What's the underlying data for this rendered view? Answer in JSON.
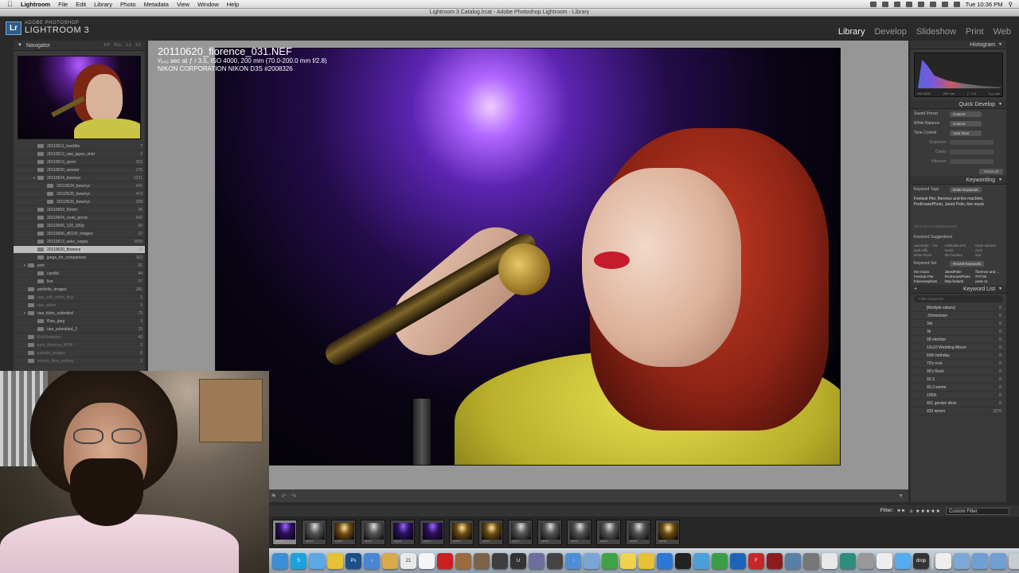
{
  "menubar": {
    "app_name": "Lightroom",
    "items": [
      "File",
      "Edit",
      "Library",
      "Photo",
      "Metadata",
      "View",
      "Window",
      "Help"
    ],
    "clock": "Tue 10:36 PM"
  },
  "window": {
    "title": "Lightroom 3 Catalog.lrcat - Adobe Photoshop Lightroom - Library"
  },
  "identity_plate": {
    "logo": "Lr",
    "small": "ADOBE PHOTOSHOP",
    "big": "LIGHTROOM 3"
  },
  "modules": [
    "Library",
    "Develop",
    "Slideshow",
    "Print",
    "Web"
  ],
  "navigator": {
    "title": "Navigator",
    "options": [
      "FIT",
      "FILL",
      "1:1",
      "3:1"
    ]
  },
  "folders": [
    {
      "name": "20110511_backlite",
      "count": "7",
      "indent": 2
    },
    {
      "name": "20110512_raw_japan_shirt",
      "count": "2",
      "indent": 2
    },
    {
      "name": "20110513_jared",
      "count": "263",
      "indent": 2
    },
    {
      "name": "20110520_weezer",
      "count": "175",
      "indent": 2
    },
    {
      "name": "20110524_bwwnyc",
      "count": "1221",
      "indent": 2,
      "open": true
    },
    {
      "name": "20110524_bwwnyc",
      "count": "420",
      "indent": 3
    },
    {
      "name": "20110525_bwwnyc",
      "count": "473",
      "indent": 3
    },
    {
      "name": "20110526_bwwnyc",
      "count": "328",
      "indent": 3
    },
    {
      "name": "20110603_50mm",
      "count": "36",
      "indent": 2
    },
    {
      "name": "20110604_roots_picnic",
      "count": "542",
      "indent": 2
    },
    {
      "name": "20110606_120_300p",
      "count": "30",
      "indent": 2
    },
    {
      "name": "20110606_d5100_images",
      "count": "22",
      "indent": 2
    },
    {
      "name": "20110613_sebc_vegas",
      "count": "1029",
      "indent": 2
    },
    {
      "name": "20110620_florence",
      "count": "94",
      "indent": 2,
      "selected": true
    },
    {
      "name": "jpegs_for_comparison",
      "count": "162",
      "indent": 2
    },
    {
      "name": "port",
      "count": "81",
      "indent": 1,
      "open": true
    },
    {
      "name": "candid",
      "count": "44",
      "indent": 2
    },
    {
      "name": "live",
      "count": "37",
      "indent": 2
    },
    {
      "name": "portfolio_images",
      "count": "181",
      "indent": 1
    },
    {
      "name": "raw_edit_video_dng",
      "count": "1",
      "indent": 1,
      "dim": true
    },
    {
      "name": "raw_edom",
      "count": "1",
      "indent": 1,
      "dim": true
    },
    {
      "name": "raw_folen_submited",
      "count": "73",
      "indent": 1,
      "open": true
    },
    {
      "name": "Raw_jpeg",
      "count": "3",
      "indent": 2
    },
    {
      "name": "raw_submitted_2",
      "count": "23",
      "indent": 2
    },
    {
      "name": "RichSamples",
      "count": "43",
      "indent": 1,
      "dim": true
    },
    {
      "name": "sam_florence_RPW",
      "count": "2",
      "indent": 1,
      "dim": true
    },
    {
      "name": "sample_images",
      "count": "6",
      "indent": 1,
      "dim": true
    },
    {
      "name": "screen_flow_waiting",
      "count": "1",
      "indent": 1,
      "dim": true
    }
  ],
  "loupe": {
    "filename": "20110620_florence_031.NEF",
    "exposure": "¹⁄₆₄₀ sec at ƒ / 3.5, ISO 4000, 200 mm (70.0-200.0 mm f/2.8)",
    "camera": "NIKON CORPORATION NIKON D3S #2008326"
  },
  "right_panel": {
    "histogram_title": "Histogram",
    "histogram_info": [
      "ISO 4000",
      "200 mm",
      "ƒ / 3.5",
      "¹⁄₆₄₀ sec"
    ],
    "quick_develop": {
      "title": "Quick Develop",
      "saved_preset_label": "Saved Preset",
      "saved_preset_value": "Custom",
      "white_balance_label": "White Balance",
      "white_balance_value": "Custom",
      "tone_control_label": "Tone Control",
      "auto_tone": "Auto Tone",
      "exposure": "Exposure",
      "clarity": "Clarity",
      "vibrance": "Vibrance",
      "reset": "Reset All"
    },
    "keywording": {
      "title": "Keywording",
      "tags_label": "Keyword Tags",
      "tags_mode": "Enter Keywords",
      "tags_text": "Festival Pier, florence and the machine, ProKnowsPhoto, Jared Polin, live music",
      "click_hint": "Click here to add keywords",
      "suggestions_title": "Keyword Suggestions",
      "suggestions": [
        "automatic : hrs",
        "editsuitecaml",
        "brian weaver",
        "walt taffy",
        "music",
        "rock",
        "Brian Rose",
        "the hooters",
        "live"
      ],
      "set_label": "Keyword Set",
      "set_value": "Recent Keywords",
      "set_items": [
        "live music",
        "JaredPolin",
        "florence and ...",
        "Festival Pier",
        "ProKnowsPhoto",
        "POTW",
        "froknowsphoto",
        "http://adsetl",
        "potw 11"
      ]
    },
    "keyword_list": {
      "title": "Keyword List",
      "filter_placeholder": "Filter Keywords",
      "items": [
        {
          "name": "[Multiple values]",
          "count": "0"
        },
        {
          "name": ".Shinedown",
          "count": "0"
        },
        {
          "name": "3rb",
          "count": "0"
        },
        {
          "name": "3k",
          "count": "0"
        },
        {
          "name": "08 election",
          "count": "0"
        },
        {
          "name": "10x10 Wedding Album",
          "count": "0"
        },
        {
          "name": "60th birthday",
          "count": "0"
        },
        {
          "name": "70's rock",
          "count": "0"
        },
        {
          "name": "90's Rock",
          "count": "0"
        },
        {
          "name": "93.3",
          "count": "0"
        },
        {
          "name": "93.3 wmmr",
          "count": "0"
        },
        {
          "name": "105th",
          "count": "0"
        },
        {
          "name": "401 gordon drive",
          "count": "0"
        },
        {
          "name": "933 wmmr",
          "count": "1070"
        }
      ]
    }
  },
  "filmstrip": {
    "filter_label": "Filter:",
    "stars": "≥ ★★★★★",
    "custom_filter": "Custom Filter",
    "thumbs": [
      {
        "style": "purple",
        "selected": true
      },
      {
        "style": "bw"
      },
      {
        "style": "warm"
      },
      {
        "style": "bw"
      },
      {
        "style": "purple"
      },
      {
        "style": "purple"
      },
      {
        "style": "warm"
      },
      {
        "style": "warm"
      },
      {
        "style": "bw"
      },
      {
        "style": "bw"
      },
      {
        "style": "bw"
      },
      {
        "style": "bw"
      },
      {
        "style": "bw"
      },
      {
        "style": "warm"
      }
    ]
  },
  "dock": [
    {
      "name": "finder",
      "color": "#3b8fd6",
      "label": ""
    },
    {
      "name": "skype",
      "color": "#19a2e0",
      "label": "S"
    },
    {
      "name": "safari",
      "color": "#5aa9e6",
      "label": ""
    },
    {
      "name": "mail",
      "color": "#e8c234",
      "label": ""
    },
    {
      "name": "photoshop",
      "color": "#1b4f8a",
      "label": "Ps"
    },
    {
      "name": "itunes",
      "color": "#4a86d6",
      "label": "♪"
    },
    {
      "name": "preview",
      "color": "#d9a94a",
      "label": ""
    },
    {
      "name": "calendar",
      "color": "#e9e9e9",
      "label": "21"
    },
    {
      "name": "textedit",
      "color": "#f5f5f5",
      "label": ""
    },
    {
      "name": "adobe",
      "color": "#cc1f1f",
      "label": ""
    },
    {
      "name": "photos",
      "color": "#9b6a3f",
      "label": ""
    },
    {
      "name": "guitar",
      "color": "#7b6349",
      "label": ""
    },
    {
      "name": "inspector",
      "color": "#3e3e3e",
      "label": ""
    },
    {
      "name": "ustream",
      "color": "#333",
      "label": "U"
    },
    {
      "name": "video",
      "color": "#6e6e9e",
      "label": ""
    },
    {
      "name": "clapper",
      "color": "#444",
      "label": ""
    },
    {
      "name": "upload",
      "color": "#4d8ed6",
      "label": "↑"
    },
    {
      "name": "finder2",
      "color": "#7aa6d6",
      "label": ""
    },
    {
      "name": "green",
      "color": "#3fa345",
      "label": ""
    },
    {
      "name": "notes",
      "color": "#f0d34d",
      "label": ""
    },
    {
      "name": "stickies",
      "color": "#e8c234",
      "label": ""
    },
    {
      "name": "network",
      "color": "#2c78d4",
      "label": ""
    },
    {
      "name": "camera",
      "color": "#222",
      "label": ""
    },
    {
      "name": "windows",
      "color": "#4ca0d9",
      "label": ""
    },
    {
      "name": "chrome",
      "color": "#3b9e47",
      "label": ""
    },
    {
      "name": "browser",
      "color": "#1f63b8",
      "label": ""
    },
    {
      "name": "filezilla",
      "color": "#c62828",
      "label": "F"
    },
    {
      "name": "flash",
      "color": "#8e1b1b",
      "label": ""
    },
    {
      "name": "tools",
      "color": "#5a7fa6",
      "label": ""
    },
    {
      "name": "folders",
      "color": "#777",
      "label": ""
    },
    {
      "name": "calculator",
      "color": "#e8e8e8",
      "label": ""
    },
    {
      "name": "timemachine",
      "color": "#2c8f7b",
      "label": ""
    },
    {
      "name": "hardware",
      "color": "#999",
      "label": ""
    },
    {
      "name": "docs",
      "color": "#eee",
      "label": ""
    },
    {
      "name": "twitter",
      "color": "#55acee",
      "label": ""
    },
    {
      "name": "dropbox",
      "color": "#333",
      "label": "drop"
    },
    {
      "name": "separator",
      "color": "#ccc",
      "label": ""
    },
    {
      "name": "stack1",
      "color": "#eee",
      "label": ""
    },
    {
      "name": "folder1",
      "color": "#7ea8d6",
      "label": ""
    },
    {
      "name": "folder2",
      "color": "#6f9fd4",
      "label": ""
    },
    {
      "name": "folder3",
      "color": "#6f9fd4",
      "label": ""
    },
    {
      "name": "trash",
      "color": "#c8ccd0",
      "label": ""
    }
  ]
}
